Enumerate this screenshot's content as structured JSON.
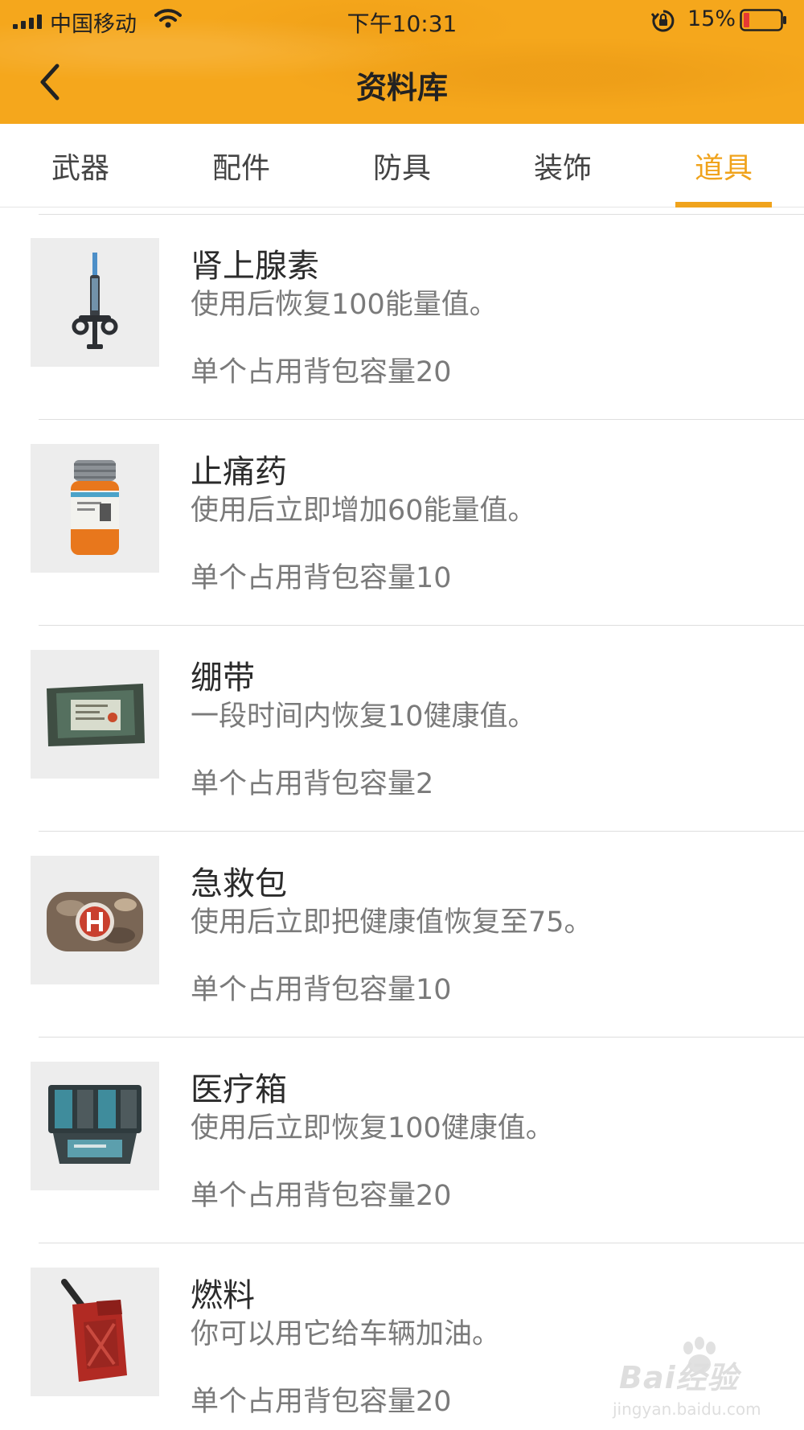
{
  "status_bar": {
    "carrier": "中国移动",
    "time": "下午10:31",
    "battery": "15%"
  },
  "nav": {
    "title": "资料库",
    "back_icon": "chevron-left-icon"
  },
  "tabs": [
    {
      "label": "武器",
      "active": false
    },
    {
      "label": "配件",
      "active": false
    },
    {
      "label": "防具",
      "active": false
    },
    {
      "label": "装饰",
      "active": false
    },
    {
      "label": "道具",
      "active": true
    }
  ],
  "items": [
    {
      "name": "肾上腺素",
      "desc": "使用后恢复100能量值。",
      "capacity": "单个占用背包容量20",
      "icon": "syringe-icon"
    },
    {
      "name": "止痛药",
      "desc": "使用后立即增加60能量值。",
      "capacity": "单个占用背包容量10",
      "icon": "pill-bottle-icon"
    },
    {
      "name": "绷带",
      "desc": "一段时间内恢复10健康值。",
      "capacity": "单个占用背包容量2",
      "icon": "bandage-icon"
    },
    {
      "name": "急救包",
      "desc": "使用后立即把健康值恢复至75。",
      "capacity": "单个占用背包容量10",
      "icon": "first-aid-kit-icon"
    },
    {
      "name": "医疗箱",
      "desc": "使用后立即恢复100健康值。",
      "capacity": "单个占用背包容量20",
      "icon": "medical-case-icon"
    },
    {
      "name": "燃料",
      "desc": "你可以用它给车辆加油。",
      "capacity": "单个占用背包容量20",
      "icon": "fuel-can-icon"
    }
  ],
  "watermark": {
    "logo": "Bai经验",
    "url": "jingyan.baidu.com"
  },
  "colors": {
    "header": "#f5a71c",
    "accent": "#f0a31c"
  }
}
